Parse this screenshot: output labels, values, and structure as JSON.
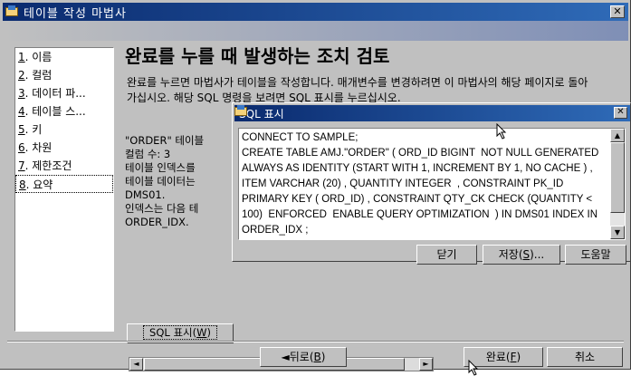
{
  "window": {
    "title": "테이블 작성 마법사",
    "close_glyph": "✕"
  },
  "nav": {
    "items": [
      {
        "num": "1",
        "label": ". 이름"
      },
      {
        "num": "2",
        "label": ". 컬럼"
      },
      {
        "num": "3",
        "label": ". 데이터 파..."
      },
      {
        "num": "4",
        "label": ". 테이블 스..."
      },
      {
        "num": "5",
        "label": ". 키"
      },
      {
        "num": "6",
        "label": ". 차원"
      },
      {
        "num": "7",
        "label": ". 제한조건"
      },
      {
        "num": "8",
        "label": ". 요약"
      }
    ],
    "selected_index": 7
  },
  "main": {
    "heading": "완료를 누를 때 발생하는 조치 검토",
    "description": "완료를 누르면 마법사가 테이블을 작성합니다. 매개변수를 변경하려면 이 마법사의 해당 페이지로 돌아가십시오. 해당 SQL 명령을 보려면 SQL 표시를 누르십시오.",
    "summary": "\"ORDER\" 테이블\n컬럼 수: 3\n테이블 인덱스를\n테이블 데이터는\nDMS01.\n인덱스는 다음 테\nORDER_IDX.",
    "sql_button_label": "SQL 표시(",
    "sql_button_mnemonic": "W",
    "sql_button_suffix": ")"
  },
  "footer": {
    "back": {
      "prefix": "◄뒤로(",
      "mnemonic": "B",
      "suffix": ")"
    },
    "finish": {
      "prefix": "완료(",
      "mnemonic": "F",
      "suffix": ")"
    },
    "cancel": "취소"
  },
  "dialog": {
    "title": "SQL 표시",
    "close_glyph": "✕",
    "sql_text": "CONNECT TO SAMPLE;\nCREATE TABLE AMJ.\"ORDER\" ( ORD_ID BIGINT  NOT NULL GENERATED ALWAYS AS IDENTITY (START WITH 1, INCREMENT BY 1, NO CACHE ) , ITEM VARCHAR (20) , QUANTITY INTEGER  , CONSTRAINT PK_ID PRIMARY KEY ( ORD_ID) , CONSTRAINT QTY_CK CHECK (QUANTITY < 100)  ENFORCED  ENABLE QUERY OPTIMIZATION  ) IN DMS01 INDEX IN ORDER_IDX ;",
    "close_button": "닫기",
    "save": {
      "prefix": "저장(",
      "mnemonic": "S",
      "suffix": ")..."
    },
    "help": "도움말"
  },
  "colors": {
    "title_gradient_start": "#0a2a6e",
    "title_gradient_end": "#2f6bb8",
    "face": "#c0c0c0"
  }
}
